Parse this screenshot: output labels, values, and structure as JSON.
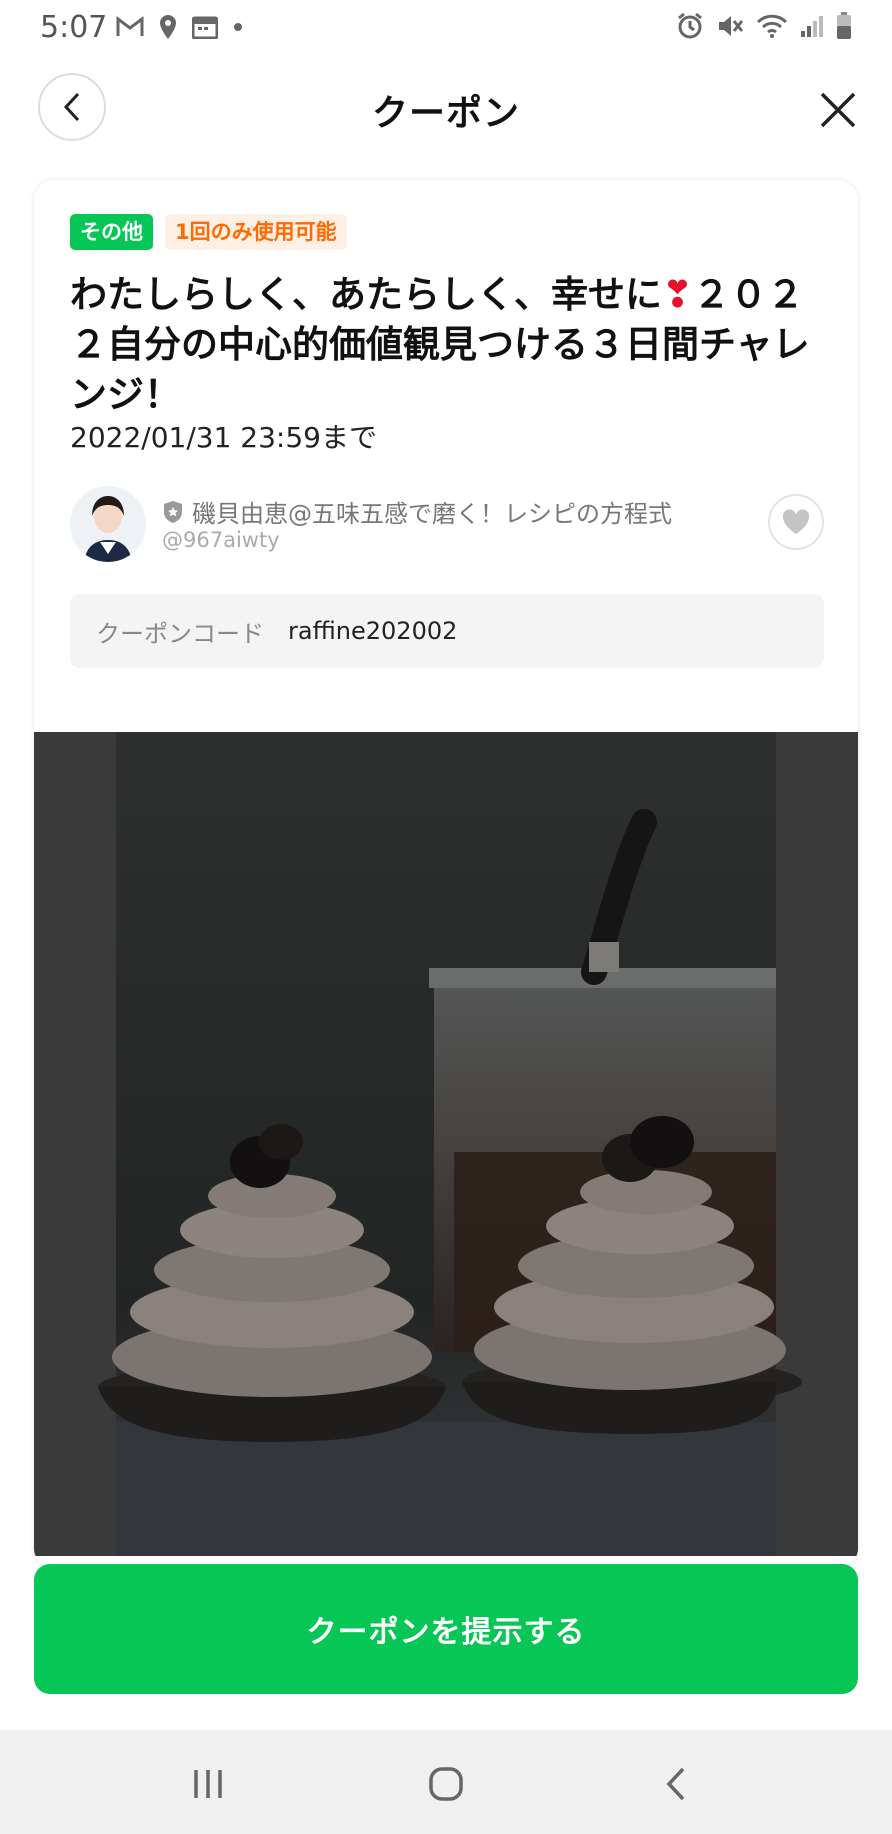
{
  "status_bar": {
    "time": "5:07",
    "left_icons": [
      "gmail-icon",
      "location-icon",
      "calendar-icon",
      "dot-icon"
    ],
    "right_icons": [
      "alarm-icon",
      "mute-icon",
      "wifi-icon",
      "signal-icon",
      "battery-icon"
    ]
  },
  "header": {
    "title": "クーポン"
  },
  "coupon": {
    "tags": [
      "その他",
      "1回のみ使用可能"
    ],
    "title_part1": "わたしらしく、あたらしく、幸せに",
    "title_emoji": "❣",
    "title_part2": "２０２２自分の中心的価値観見つける３日間チャレンジ！",
    "expiry": "2022/01/31 23:59まで",
    "author": {
      "name": "磯貝由恵@五味五感で磨く！レシピの方程式",
      "id": "@967aiwty"
    },
    "code_label": "クーポンコード",
    "code_value": "raffine202002",
    "button_label": "クーポンを提示する"
  },
  "colors": {
    "accent_green": "#06c755",
    "tag_orange": "#ff6a00",
    "tag_orange_bg": "#fff0e6"
  },
  "navbar": {
    "icons": [
      "recent-apps-icon",
      "home-icon",
      "back-icon"
    ]
  }
}
